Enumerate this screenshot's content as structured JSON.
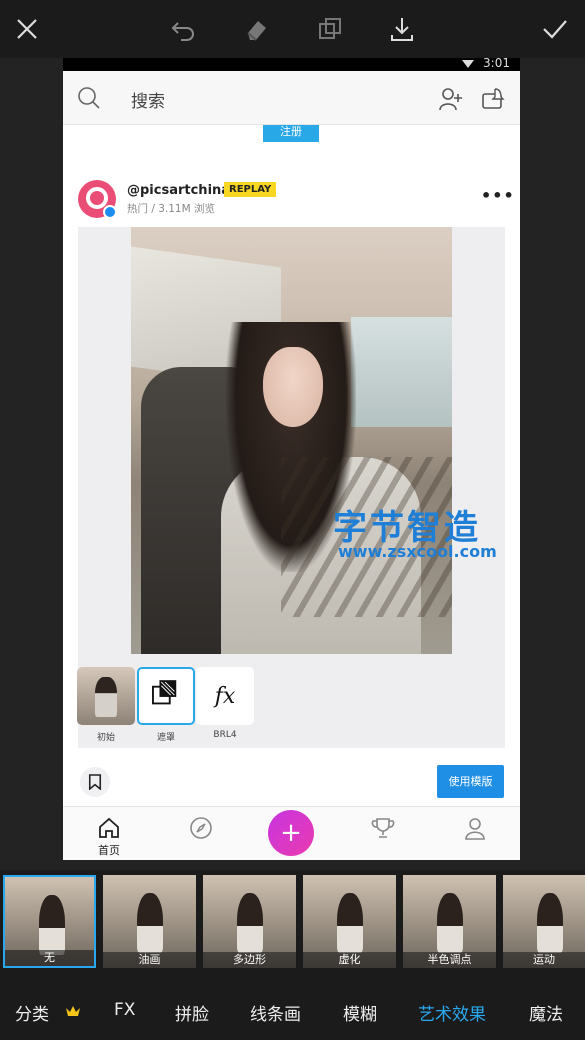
{
  "toolbar": {
    "close_icon": "close-icon",
    "undo_icon": "undo-icon",
    "eraser_icon": "eraser-icon",
    "layers_icon": "layers-icon",
    "download_icon": "download-icon",
    "apply_icon": "check-icon"
  },
  "phone": {
    "status_time": "3:01",
    "search_placeholder": "搜索",
    "register_label": "注册",
    "post": {
      "username": "@picsartchina",
      "badge": "REPLAY",
      "meta": "热门 / 3.11M 浏览",
      "more": "•••"
    },
    "effects": [
      {
        "label": "初始"
      },
      {
        "label": "遮罩"
      },
      {
        "label": "BRL4",
        "glyph": "fx"
      }
    ],
    "use_template_label": "使用模版",
    "nav": {
      "home_label": "首页",
      "add_glyph": "+"
    }
  },
  "watermark": {
    "title": "字节智造",
    "url": "www.zsxcool.com"
  },
  "filter_strip": [
    {
      "label": "无",
      "selected": true
    },
    {
      "label": "油画"
    },
    {
      "label": "多边形"
    },
    {
      "label": "虚化"
    },
    {
      "label": "半色调点"
    },
    {
      "label": "运动"
    }
  ],
  "categories": [
    {
      "label": "分类"
    },
    {
      "label": "FX"
    },
    {
      "label": "拼脸"
    },
    {
      "label": "线条画"
    },
    {
      "label": "模糊"
    },
    {
      "label": "艺术效果",
      "active": true
    },
    {
      "label": "魔法"
    }
  ],
  "colors": {
    "accent": "#2aa8ef",
    "fab": "#d236d0",
    "replay": "#f8d723"
  }
}
